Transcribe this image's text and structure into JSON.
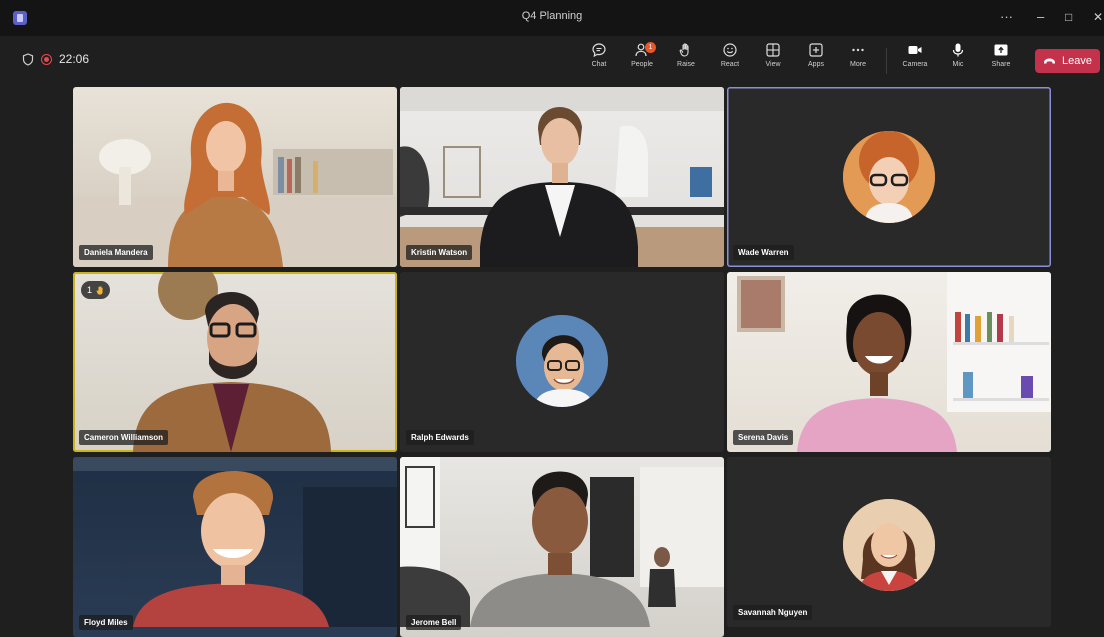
{
  "window": {
    "title": "Q4 Planning",
    "more": "···",
    "minimize": "–",
    "restore": "□",
    "close": "✕"
  },
  "status": {
    "timer": "22:06"
  },
  "toolbar": {
    "chat": "Chat",
    "people": "People",
    "people_badge": "1",
    "raise": "Raise",
    "react": "React",
    "view": "View",
    "apps": "Apps",
    "more": "More",
    "camera": "Camera",
    "mic": "Mic",
    "share": "Share",
    "leave": "Leave"
  },
  "participants": [
    {
      "name": "Daniela Mandera"
    },
    {
      "name": "Kristin Watson"
    },
    {
      "name": "Wade Warren"
    },
    {
      "name": "Cameron Williamson",
      "raise_order": "1"
    },
    {
      "name": "Ralph Edwards"
    },
    {
      "name": "Serena Davis"
    },
    {
      "name": "Floyd Miles"
    },
    {
      "name": "Jerome Bell"
    },
    {
      "name": "Savannah Nguyen"
    }
  ],
  "colors": {
    "leave": "#c4314b",
    "active_speaker": "#c9b420",
    "accent": "#5b5fc7"
  }
}
